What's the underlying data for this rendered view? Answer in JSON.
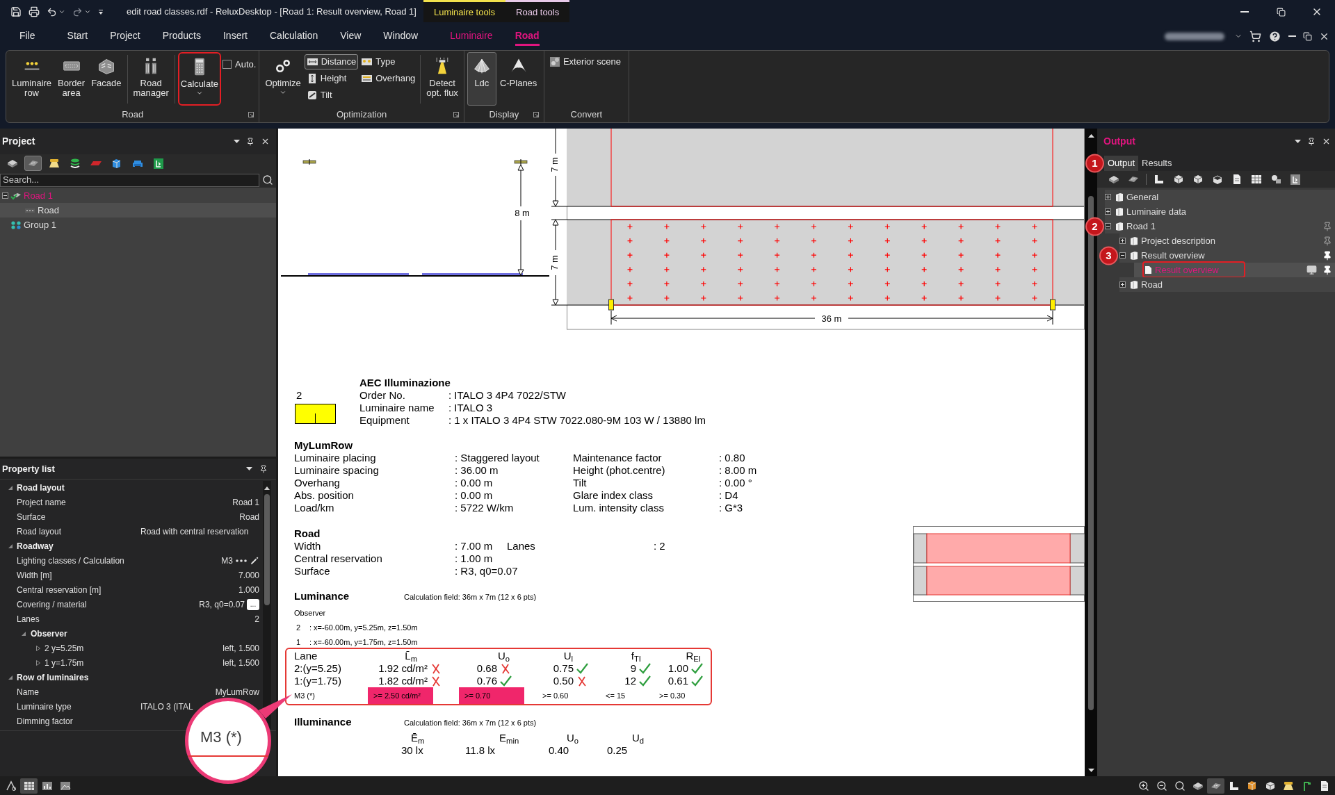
{
  "window": {
    "title": "edit road classes.rdf - ReluxDesktop - [Road 1: Result overview, Road 1]",
    "context_tabs": [
      {
        "label": "Luminaire tools",
        "color": "#f2e14c"
      },
      {
        "label": "Road tools",
        "color": "#e8c9e8"
      }
    ]
  },
  "menu": [
    {
      "label": "File",
      "kind": "main",
      "selected": false
    },
    {
      "label": "Start",
      "kind": "main",
      "selected": false
    },
    {
      "label": "Project",
      "kind": "main",
      "selected": false
    },
    {
      "label": "Products",
      "kind": "main",
      "selected": false
    },
    {
      "label": "Insert",
      "kind": "main",
      "selected": false
    },
    {
      "label": "Calculation",
      "kind": "main",
      "selected": false
    },
    {
      "label": "View",
      "kind": "main",
      "selected": false
    },
    {
      "label": "Window",
      "kind": "main",
      "selected": false
    },
    {
      "label": "Luminaire",
      "kind": "context",
      "selected": false
    },
    {
      "label": "Road",
      "kind": "context",
      "selected": true
    }
  ],
  "ribbon": {
    "groups": [
      {
        "label": "Road",
        "launcher": true,
        "sets": [
          [
            {
              "kind": "large",
              "label": "Luminaire\nrow"
            },
            {
              "kind": "large",
              "label": "Border\narea"
            },
            {
              "kind": "large",
              "label": "Facade"
            }
          ],
          [
            {
              "kind": "large",
              "label": "Road\nmanager"
            }
          ],
          [
            {
              "kind": "large",
              "label": "Calculate",
              "dropdown": true,
              "highlighted": true
            },
            {
              "kind": "check",
              "label": "Auto.",
              "checked": false
            }
          ]
        ]
      },
      {
        "label": "Optimization",
        "launcher": true,
        "sets": [
          [
            {
              "kind": "large",
              "label": "Optimize",
              "dropdown": true
            },
            {
              "kind": "stack",
              "items": [
                {
                  "label": "Distance",
                  "selected": true
                },
                {
                  "label": "Height",
                  "selected": false
                },
                {
                  "label": "Tilt",
                  "selected": false
                }
              ]
            },
            {
              "kind": "stack",
              "items": [
                {
                  "label": "Type",
                  "selected": false
                },
                {
                  "label": "Overhang",
                  "selected": false
                }
              ]
            }
          ],
          [
            {
              "kind": "large",
              "label": "Detect\nopt. flux"
            }
          ]
        ]
      },
      {
        "label": "Display",
        "launcher": true,
        "sets": [
          [
            {
              "kind": "large",
              "label": "Ldc",
              "selected": true
            },
            {
              "kind": "large",
              "label": "C-Planes",
              "selected": false
            }
          ]
        ]
      },
      {
        "label": "Convert",
        "sets": [
          [
            {
              "kind": "stack",
              "items": [
                {
                  "label": "Exterior scene"
                }
              ]
            }
          ]
        ]
      }
    ]
  },
  "project_panel": {
    "title": "Project",
    "toolbar": [
      {
        "selected": false
      },
      {
        "selected": true
      },
      {
        "selected": false
      },
      {
        "selected": false
      },
      {
        "selected": false
      },
      {
        "selected": false
      },
      {
        "selected": false
      },
      {
        "selected": false
      }
    ],
    "search": {
      "placeholder": "Search..."
    },
    "tree": [
      {
        "kind": "project",
        "label": "Road 1",
        "current": true,
        "selected": false,
        "expanded": true,
        "children": [
          {
            "kind": "road",
            "label": "Road",
            "current": false,
            "selected": true
          }
        ]
      },
      {
        "kind": "group",
        "label": "Group 1",
        "current": false,
        "selected": false
      }
    ]
  },
  "property_list": {
    "title": "Property list",
    "sections": [
      {
        "label": "Road layout",
        "expanded": true,
        "rows": [
          {
            "kind": "text",
            "name": "Project name",
            "value": "Road 1"
          },
          {
            "kind": "text",
            "name": "Surface",
            "value": "Road"
          },
          {
            "kind": "combo",
            "name": "Road layout",
            "value": "Road with central reservation"
          }
        ]
      },
      {
        "label": "Roadway",
        "expanded": true,
        "rows": [
          {
            "kind": "class",
            "name": "Lighting classes / Calculation",
            "value": "M3"
          },
          {
            "kind": "text",
            "name": "Width [m]",
            "value": "7.000"
          },
          {
            "kind": "text",
            "name": "Central reservation [m]",
            "value": "1.000"
          },
          {
            "kind": "browse",
            "name": "Covering / material",
            "value": "R3, q0=0.07",
            "button": "..."
          },
          {
            "kind": "text",
            "name": "Lanes",
            "value": "2"
          },
          {
            "kind": "group",
            "name": "Observer",
            "expanded": true,
            "children": [
              {
                "kind": "item",
                "name": "2 y=5.25m",
                "value": "left, 1.500",
                "expanded": false
              },
              {
                "kind": "item",
                "name": "1 y=1.75m",
                "value": "left, 1.500",
                "expanded": false
              }
            ]
          }
        ]
      },
      {
        "label": "Row of luminaires",
        "expanded": true,
        "rows": [
          {
            "kind": "text",
            "name": "Name",
            "value": "MyLumRow"
          },
          {
            "kind": "combo",
            "name": "Luminaire type",
            "value": "ITALO 3 (ITAL"
          },
          {
            "kind": "text",
            "name": "Dimming factor"
          }
        ]
      }
    ]
  },
  "document": {
    "drawing": {
      "mounting_height": "8 m",
      "road_widths": [
        "7 m",
        "7 m"
      ],
      "spacing": "36 m"
    },
    "luminaire": {
      "count": "2",
      "manufacturer": "AEC Illuminazione",
      "fields": [
        {
          "label": "Order No.",
          "value": ": ITALO 3 4P4 7022/STW"
        },
        {
          "label": "Luminaire name",
          "value": ": ITALO 3"
        },
        {
          "label": "Equipment",
          "value": ": 1 x ITALO 3 4P4 STW 7022.080-9M 103 W / 13880 lm"
        }
      ]
    },
    "luminaire_row": {
      "title": "MyLumRow",
      "rows": [
        [
          "Luminaire placing",
          ": Staggered layout",
          "Maintenance factor",
          ": 0.80"
        ],
        [
          "Luminaire spacing",
          ": 36.00 m",
          "Height (phot.centre)",
          ": 8.00 m"
        ],
        [
          "Overhang",
          ": 0.00 m",
          "Tilt",
          ": 0.00 °"
        ],
        [
          "Abs. position",
          ": 0.00 m",
          "Glare index class",
          ": D4"
        ],
        [
          "Load/km",
          ": 5722 W/km",
          "Lum. intensity class",
          ": G*3"
        ]
      ]
    },
    "road": {
      "title": "Road",
      "rows": [
        [
          "Width",
          ": 7.00 m",
          "Lanes",
          ": 2"
        ],
        [
          "Central reservation",
          ": 1.00 m"
        ],
        [
          "Surface",
          ": R3, q0=0.07"
        ]
      ]
    },
    "luminance": {
      "title": "Luminance",
      "field": "Calculation field: 36m x 7m (12 x 6 pts)",
      "observer_title": "Observer",
      "observers": [
        {
          "number": "2",
          "position": ": x=-60.00m, y=5.25m, z=1.50m"
        },
        {
          "number": "1",
          "position": ": x=-60.00m, y=1.75m, z=1.50m"
        }
      ],
      "table": {
        "highlighted": true,
        "lane_title": "Lane",
        "columns": [
          "L̄$_{m}$",
          "U$_{o}$",
          "U$_{l}$",
          "f$_{TI}$",
          "R$_{EI}$"
        ],
        "rows": [
          {
            "lane": "2:(y=5.25)",
            "cells": [
              {
                "value": "1.92 cd/m²",
                "pass": false
              },
              {
                "value": "0.68",
                "pass": false
              },
              {
                "value": "0.75",
                "pass": true
              },
              {
                "value": "9",
                "pass": true
              },
              {
                "value": "1.00",
                "pass": true
              }
            ]
          },
          {
            "lane": "1:(y=1.75)",
            "cells": [
              {
                "value": "1.82 cd/m²",
                "pass": false
              },
              {
                "value": "0.76",
                "pass": true
              },
              {
                "value": "0.50",
                "pass": false
              },
              {
                "value": "12",
                "pass": true
              },
              {
                "value": "0.61",
                "pass": true
              }
            ]
          }
        ],
        "requirement": {
          "class": "M3 (*)",
          "limits": [
            {
              "value": ">= 2.50 cd/m²",
              "highlighted": true
            },
            {
              "value": ">= 0.70",
              "highlighted": true
            },
            {
              "value": ">= 0.60",
              "highlighted": false
            },
            {
              "value": "<= 15",
              "highlighted": false
            },
            {
              "value": ">= 0.30",
              "highlighted": false
            }
          ]
        }
      }
    },
    "illuminance": {
      "title": "Illuminance",
      "field": "Calculation field: 36m x 7m (12 x 6 pts)",
      "columns": [
        "Ē$_{m}$",
        "E$_{min}$",
        "U$_{o}$",
        "U$_{d}$"
      ],
      "values": [
        "30 lx",
        "11.8 lx",
        "0.40",
        "0.25"
      ]
    }
  },
  "output_panel": {
    "title": "Output",
    "tabs": [
      {
        "label": "Output",
        "selected": true,
        "badge": "1"
      },
      {
        "label": "Results",
        "selected": false
      }
    ],
    "tree": [
      {
        "kind": "book",
        "label": "General",
        "expanded": false,
        "selected": false
      },
      {
        "kind": "book",
        "label": "Luminaire data",
        "expanded": false,
        "selected": false
      },
      {
        "kind": "book",
        "label": "Road 1",
        "expanded": true,
        "selected": false,
        "badge": "2",
        "pinned": false,
        "children": [
          {
            "kind": "book",
            "label": "Project description",
            "expanded": false,
            "selected": false,
            "pinned": false
          },
          {
            "kind": "book",
            "label": "Result overview",
            "expanded": true,
            "selected": false,
            "badge": "3",
            "pinned": true,
            "children": [
              {
                "kind": "page",
                "label": "Result overview",
                "selected": true,
                "highlighted": true,
                "pinned": true
              }
            ]
          },
          {
            "kind": "book",
            "label": "Road",
            "expanded": false,
            "selected": false
          }
        ]
      }
    ]
  },
  "status_bar": {
    "left_tools": [
      {
        "selected": false
      },
      {
        "selected": true
      },
      {
        "selected": false
      },
      {
        "selected": false
      }
    ],
    "right_tools": [
      {
        "selected": false
      },
      {
        "selected": false
      },
      {
        "selected": false
      },
      {
        "selected": false
      },
      {
        "selected": true
      },
      {
        "selected": false
      },
      {
        "selected": false
      },
      {
        "selected": false
      },
      {
        "selected": false
      },
      {
        "selected": false
      },
      {
        "selected": false
      }
    ]
  },
  "magnifier": {
    "text": "M3 (*)"
  }
}
